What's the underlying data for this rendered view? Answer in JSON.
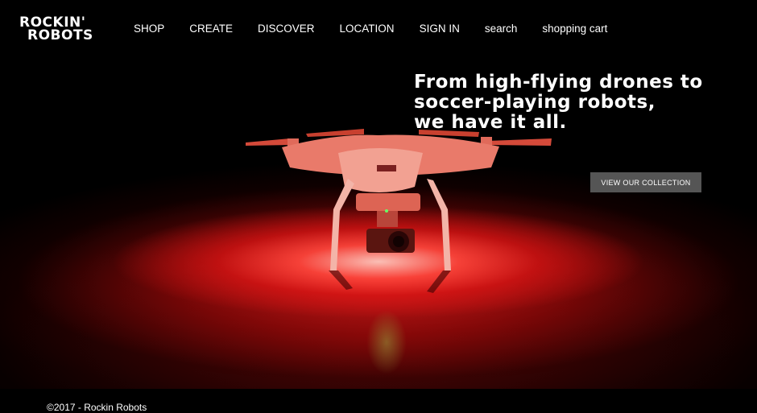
{
  "brand": {
    "line1": "ROCKIN'",
    "line2": "ROBOTS"
  },
  "nav": [
    {
      "id": "shop",
      "label": "SHOP"
    },
    {
      "id": "create",
      "label": "CREATE"
    },
    {
      "id": "discover",
      "label": "DISCOVER"
    },
    {
      "id": "location",
      "label": "LOCATION"
    },
    {
      "id": "signin",
      "label": "SIGN IN"
    },
    {
      "id": "search",
      "label": "search"
    },
    {
      "id": "cart",
      "label": "shopping cart"
    }
  ],
  "hero": {
    "headline": [
      "From high-flying drones to",
      "soccer-playing robots,",
      "we have it all."
    ],
    "cta_label": "VIEW OUR COLLECTION"
  },
  "footer": {
    "copyright": "©2017 - Rockin Robots"
  },
  "colors": {
    "background": "#000000",
    "glow": "#e01414",
    "button": "#555555"
  }
}
